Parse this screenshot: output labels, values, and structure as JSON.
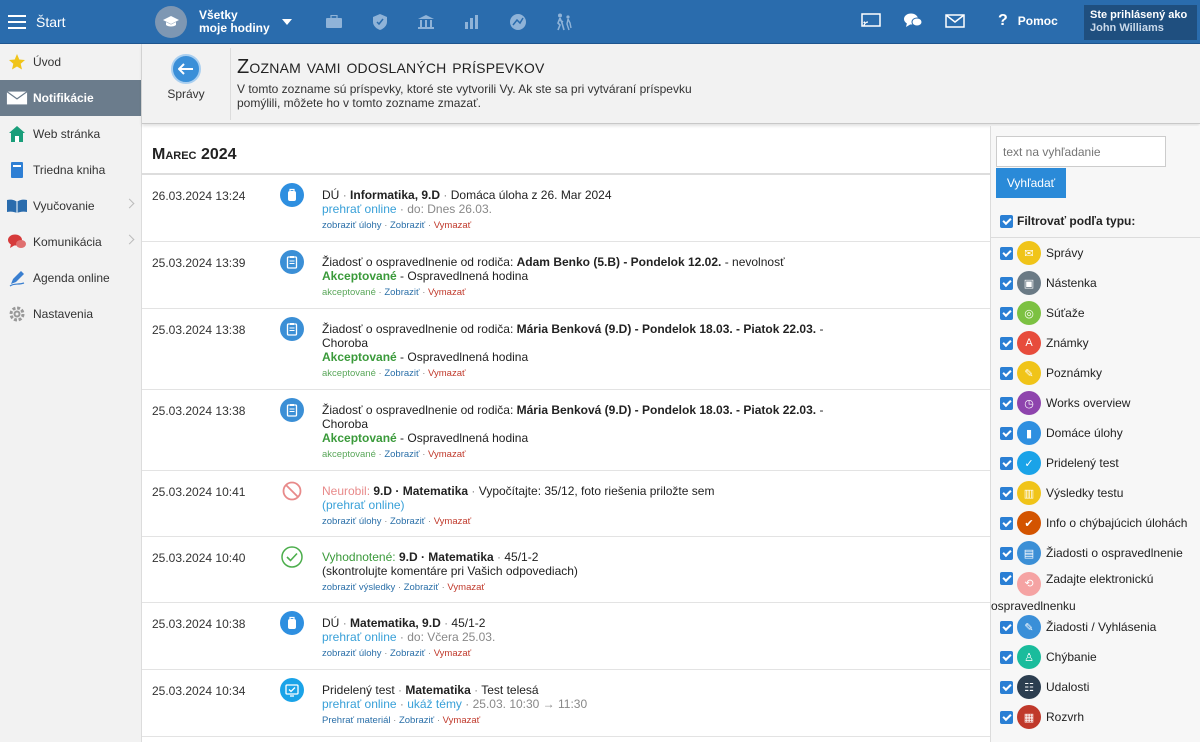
{
  "topbar": {
    "start_label": "Štart",
    "classes_line1": "Všetky",
    "classes_line2": "moje hodiny",
    "help_label": "Pomoc",
    "help_mark": "?",
    "user_label": "Ste prihlásený ako",
    "user_name": "John Williams"
  },
  "sidebar": {
    "items": [
      {
        "label": "Úvod"
      },
      {
        "label": "Notifikácie"
      },
      {
        "label": "Web stránka"
      },
      {
        "label": "Triedna kniha"
      },
      {
        "label": "Vyučovanie"
      },
      {
        "label": "Komunikácia"
      },
      {
        "label": "Agenda online"
      },
      {
        "label": "Nastavenia"
      }
    ]
  },
  "header": {
    "back_label": "Správy",
    "title": "Zoznam vami odoslaných príspevkov",
    "desc": "V tomto zozname sú príspevky, ktoré ste vytvorili Vy. Ak ste sa pri vytváraní príspevku pomýlili, môžete ho v tomto zozname zmazať."
  },
  "main": {
    "month": "Marec 2024",
    "rows": [
      {
        "date": "26.03.2024 13:24",
        "l1_a": "DÚ",
        "l1_b": "Informatika, 9.D",
        "l1_c": "Domáca úloha z 26. Mar 2024",
        "l2_link": "prehrať online",
        "l2_grey": "do: Dnes 26.03.",
        "act1": "zobraziť úlohy",
        "act2": "Zobraziť",
        "act3": "Vymazať"
      },
      {
        "date": "25.03.2024 13:39",
        "l1_a": "Žiadosť o ospravedlnenie od rodiča:",
        "l1_b": "Adam Benko (5.B) - Pondelok 12.02.",
        "l1_c": "- nevolnosť",
        "l2_status": "Akceptované",
        "l2_rest": "- Ospravedlnená hodina",
        "act1": "akceptované",
        "act2": "Zobraziť",
        "act3": "Vymazať"
      },
      {
        "date": "25.03.2024 13:38",
        "l1_a": "Žiadosť o ospravedlnenie od rodiča:",
        "l1_b": "Mária Benková (9.D) - Pondelok 18.03. - Piatok 22.03.",
        "l1_c": "- Choroba",
        "l2_status": "Akceptované",
        "l2_rest": "- Ospravedlnená hodina",
        "act1": "akceptované",
        "act2": "Zobraziť",
        "act3": "Vymazať"
      },
      {
        "date": "25.03.2024 13:38",
        "l1_a": "Žiadosť o ospravedlnenie od rodiča:",
        "l1_b": "Mária Benková (9.D) - Pondelok 18.03. - Piatok 22.03.",
        "l1_c": "- Choroba",
        "l2_status": "Akceptované",
        "l2_rest": "- Ospravedlnená hodina",
        "act1": "akceptované",
        "act2": "Zobraziť",
        "act3": "Vymazať"
      },
      {
        "date": "25.03.2024 10:41",
        "l1_a": "Neurobil:",
        "l1_b": "9.D · Matematika",
        "l1_c": "Vypočítajte: 35/12, foto riešenia priložte sem",
        "l2_link": "(prehrať online)",
        "act1": "zobraziť úlohy",
        "act2": "Zobraziť",
        "act3": "Vymazať"
      },
      {
        "date": "25.03.2024 10:40",
        "l1_a": "Vyhodnotené:",
        "l1_b": "9.D · Matematika",
        "l1_c": "45/1-2",
        "l2_plain": "(skontrolujte komentáre pri Vašich odpovediach)",
        "act1": "zobraziť výsledky",
        "act2": "Zobraziť",
        "act3": "Vymazať"
      },
      {
        "date": "25.03.2024 10:38",
        "l1_a": "DÚ",
        "l1_b": "Matematika, 9.D",
        "l1_c": "45/1-2",
        "l2_link": "prehrať online",
        "l2_grey": "do: Včera 25.03.",
        "act1": "zobraziť úlohy",
        "act2": "Zobraziť",
        "act3": "Vymazať"
      },
      {
        "date": "25.03.2024 10:34",
        "l1_a": "Pridelený test",
        "l1_b": "Matematika",
        "l1_c": "Test telesá",
        "l2_link": "prehrať online",
        "l2_link2": "ukáž témy",
        "l2_grey": "25.03. 10:30 → 11:30",
        "act1": "Prehrať materiál",
        "act2": "Zobraziť",
        "act3": "Vymazať"
      }
    ]
  },
  "right": {
    "search_placeholder": "text na vyhľadanie",
    "search_button": "Vyhľadať",
    "filter_title": "Filtrovať podľa typu:",
    "filters": [
      {
        "label": "Správy",
        "color": "#f0c419"
      },
      {
        "label": "Nástenka",
        "color": "#6a7a85"
      },
      {
        "label": "Súťaže",
        "color": "#7cc142"
      },
      {
        "label": "Známky",
        "color": "#e74c3c"
      },
      {
        "label": "Poznámky",
        "color": "#f0c419"
      },
      {
        "label": "Works overview",
        "color": "#8e44ad"
      },
      {
        "label": "Domáce úlohy",
        "color": "#2e8fe0"
      },
      {
        "label": "Pridelený test",
        "color": "#1aa3e8"
      },
      {
        "label": "Výsledky testu",
        "color": "#f0c419"
      },
      {
        "label": "Info o chýbajúcich úlohách",
        "color": "#d35400"
      },
      {
        "label": "Žiadosti o ospravedlnenie",
        "color": "#3b8fd6"
      },
      {
        "label": "Zadajte elektronickú",
        "label2": "ospravedlnenku",
        "color": "#f5a3a3"
      },
      {
        "label": "Žiadosti / Vyhlásenia",
        "color": "#3a8fd8"
      },
      {
        "label": "Chýbanie",
        "color": "#1abc9c"
      },
      {
        "label": "Udalosti",
        "color": "#2c3e50"
      },
      {
        "label": "Rozvrh",
        "color": "#c0392b"
      }
    ]
  },
  "colors": {
    "topbar": "#2a6cad",
    "accent_blue": "#2a8ad8",
    "active_nav": "#6b7c8c"
  }
}
